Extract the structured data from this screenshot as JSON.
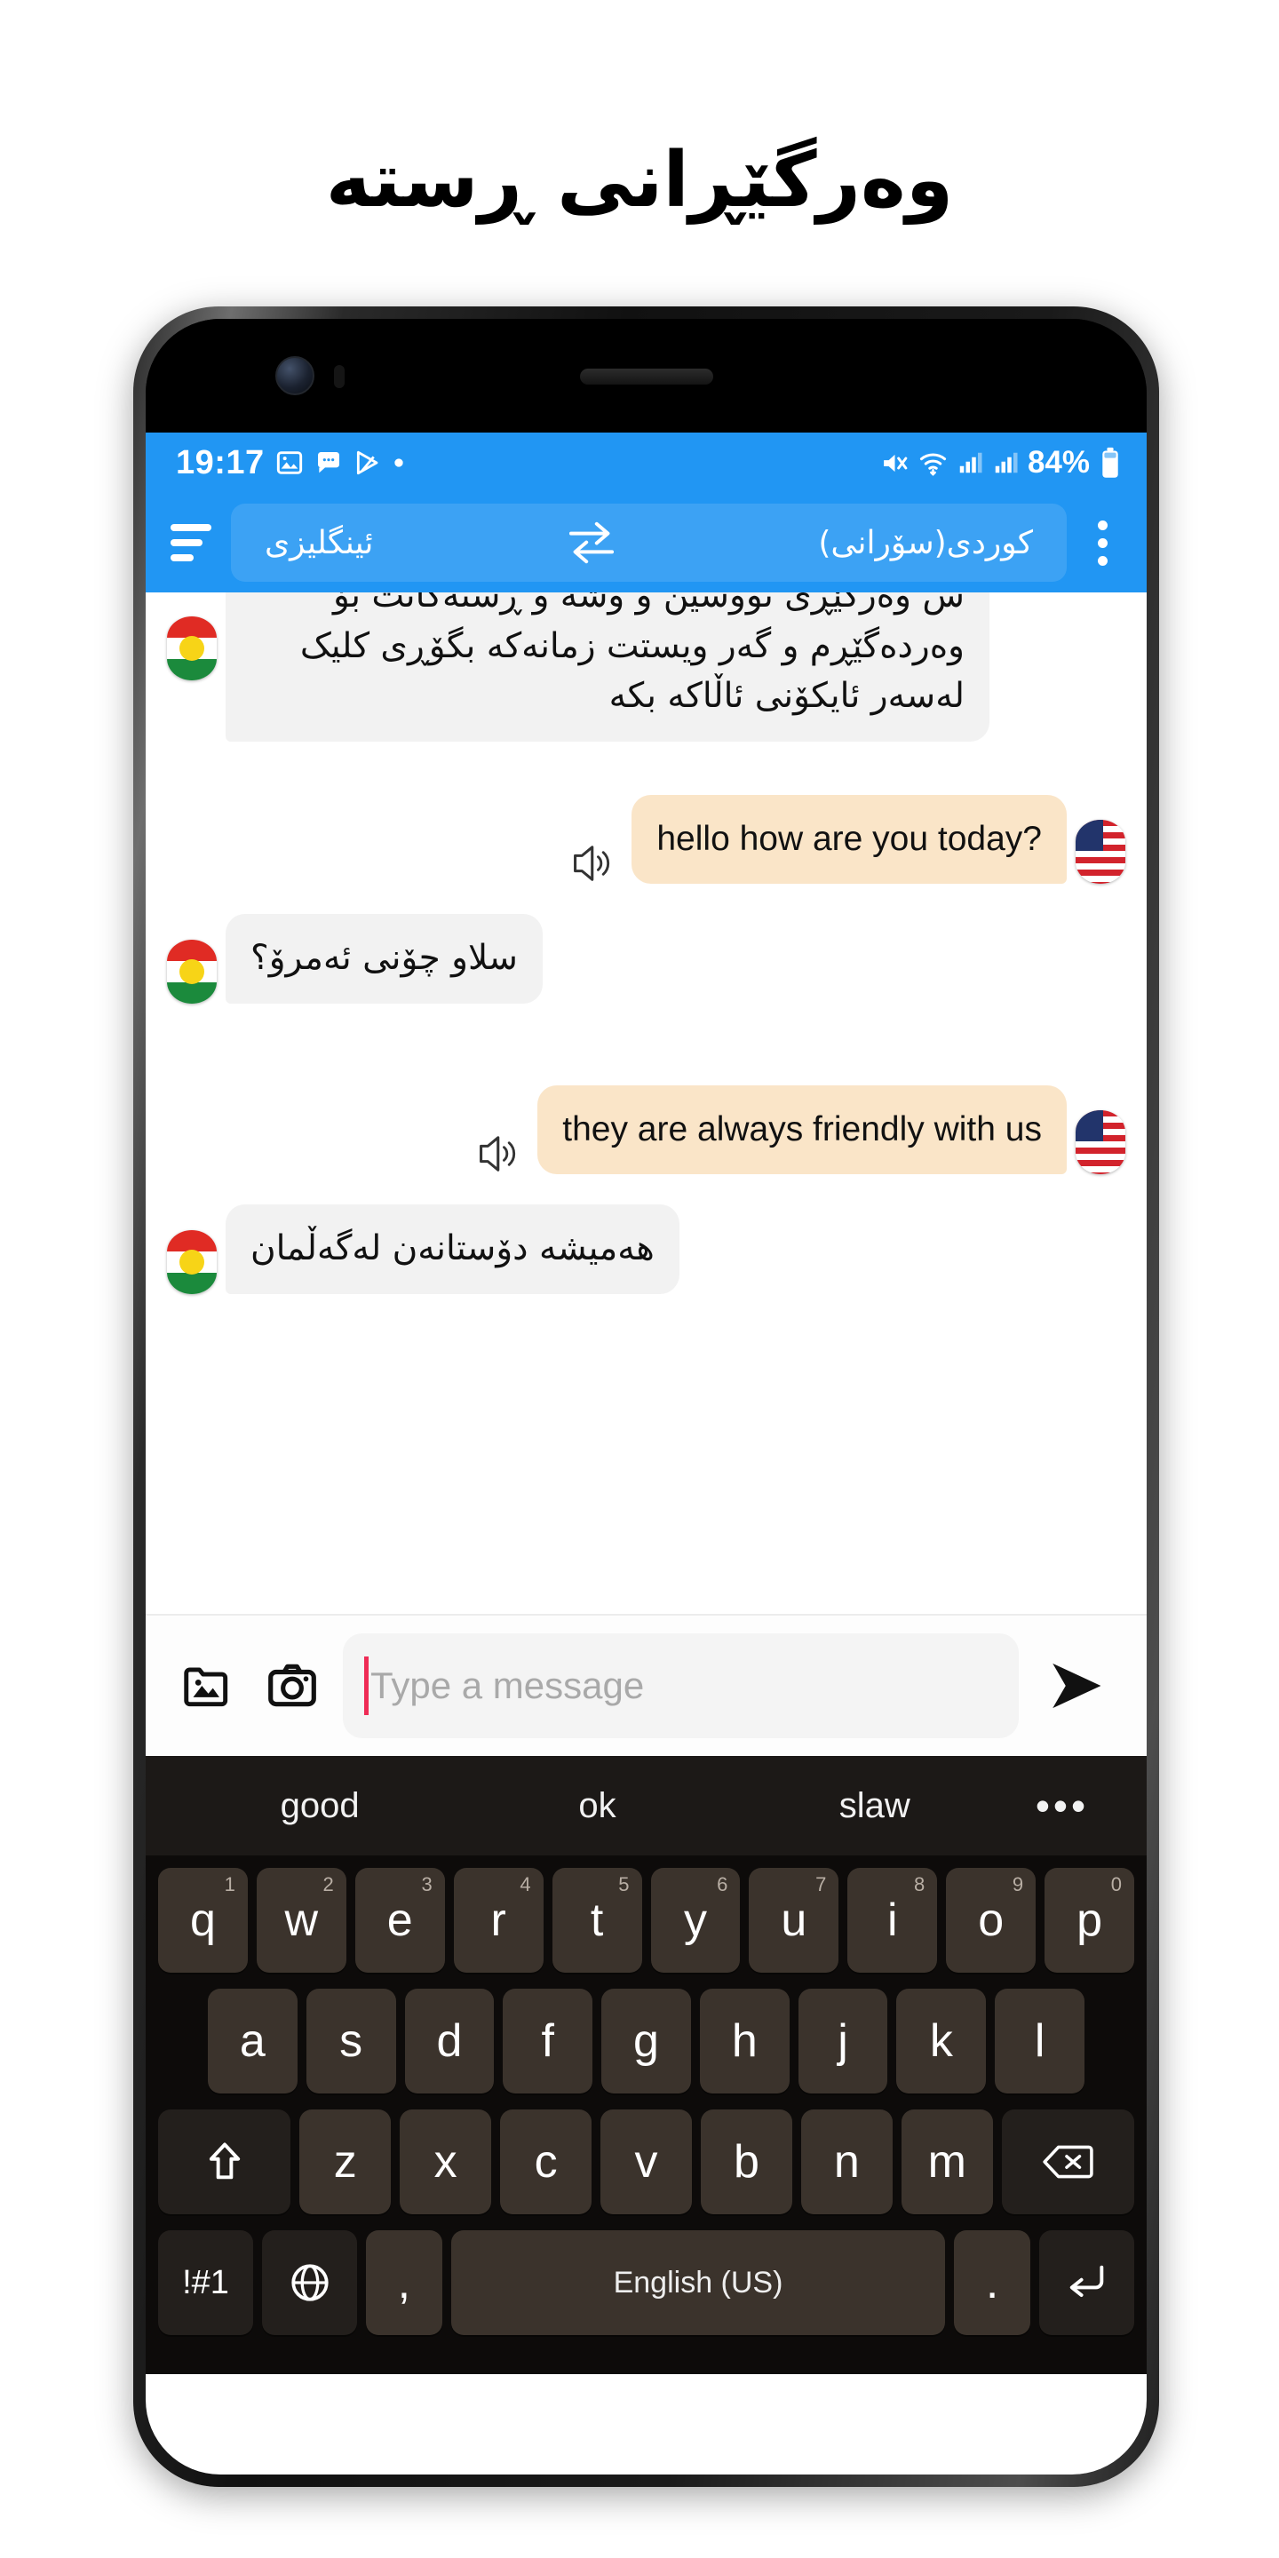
{
  "headline": "وەرگێڕانی ڕستە",
  "status_bar": {
    "time": "19:17",
    "battery_percent": "84%",
    "icons": [
      "image-icon",
      "chat-bubble-icon",
      "send-play-icon",
      "dot-icon",
      "mute-icon",
      "wifi-icon",
      "signal-1-icon",
      "signal-2-icon",
      "battery-icon"
    ]
  },
  "toolbar": {
    "menu_icon": "hamburger-sort-icon",
    "source_language": "ئینگلیزی",
    "swap_icon": "swap-arrows-icon",
    "target_language": "کوردی(سۆرانی)",
    "overflow_icon": "more-vertical-icon",
    "background_color": "#2196f3"
  },
  "chat": {
    "messages": [
      {
        "id": "msg-intro",
        "side": "left",
        "lang": "ku",
        "flag": "kurdistan-flag",
        "clipped": true,
        "text": "س وەرگێڕی نووسین و وشە و ڕستەکانت بۆ وەردەگێڕم و گەر ویستت زمانەکە بگۆڕی کلیک لەسەر ئایکۆنی ئاڵاکە بکە"
      },
      {
        "id": "msg-en-1",
        "side": "right",
        "lang": "en",
        "flag": "usa-flag",
        "speaker_icon": "speaker-sound-icon",
        "text": "hello how are you today?"
      },
      {
        "id": "msg-ku-1",
        "side": "left",
        "lang": "ku",
        "flag": "kurdistan-flag",
        "text": "سلاو چۆنی ئەمرۆ؟"
      },
      {
        "id": "msg-en-2",
        "side": "right",
        "lang": "en",
        "flag": "usa-flag",
        "speaker_icon": "speaker-sound-icon",
        "text": "they are always friendly with us"
      },
      {
        "id": "msg-ku-2",
        "side": "left",
        "lang": "ku",
        "flag": "kurdistan-flag",
        "text": "هەمیشە دۆستانەن لەگەڵمان"
      }
    ],
    "bubble_colors": {
      "incoming": "#f2f2f2",
      "outgoing": "#fae5c8"
    }
  },
  "composer": {
    "gallery_icon": "image-gallery-icon",
    "camera_icon": "camera-icon",
    "placeholder": "Type a message",
    "value": "",
    "caret_color": "#ef2b55",
    "send_icon": "send-arrow-icon"
  },
  "keyboard": {
    "suggestions": [
      "good",
      "ok",
      "slaw"
    ],
    "more_icon": "more-horizontal-icon",
    "rows": [
      [
        {
          "label": "q",
          "num": "1"
        },
        {
          "label": "w",
          "num": "2"
        },
        {
          "label": "e",
          "num": "3"
        },
        {
          "label": "r",
          "num": "4"
        },
        {
          "label": "t",
          "num": "5"
        },
        {
          "label": "y",
          "num": "6"
        },
        {
          "label": "u",
          "num": "7"
        },
        {
          "label": "i",
          "num": "8"
        },
        {
          "label": "o",
          "num": "9"
        },
        {
          "label": "p",
          "num": "0"
        }
      ],
      [
        {
          "label": "a"
        },
        {
          "label": "s"
        },
        {
          "label": "d"
        },
        {
          "label": "f"
        },
        {
          "label": "g"
        },
        {
          "label": "h"
        },
        {
          "label": "j"
        },
        {
          "label": "k"
        },
        {
          "label": "l"
        }
      ],
      [
        {
          "label": "",
          "icon": "shift-icon",
          "kind": "dark-wide"
        },
        {
          "label": "z"
        },
        {
          "label": "x"
        },
        {
          "label": "c"
        },
        {
          "label": "v"
        },
        {
          "label": "b"
        },
        {
          "label": "n"
        },
        {
          "label": "m"
        },
        {
          "label": "",
          "icon": "backspace-icon",
          "kind": "dark-wide"
        }
      ],
      [
        {
          "label": "!#1",
          "kind": "dark"
        },
        {
          "label": "",
          "icon": "globe-language-icon",
          "kind": "dark"
        },
        {
          "label": ",",
          "kind": "normal"
        },
        {
          "label": "English (US)",
          "kind": "space"
        },
        {
          "label": ".",
          "kind": "normal"
        },
        {
          "label": "",
          "icon": "enter-return-icon",
          "kind": "dark"
        }
      ]
    ],
    "key_color": "#3b332c",
    "background_color": "#0d0b0a"
  }
}
